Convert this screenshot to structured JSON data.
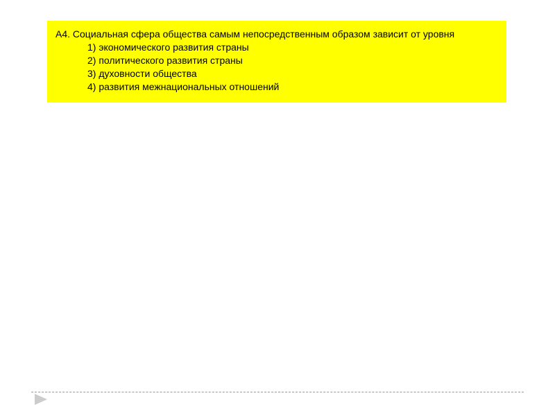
{
  "question": {
    "prompt": "А4. Социальная сфера общества самым непосредственным образом зависит от уровня",
    "options": [
      "1) экономического развития страны",
      "2) политического развития страны",
      "3) духовности общества",
      "4) развития межнациональных отношений"
    ]
  }
}
